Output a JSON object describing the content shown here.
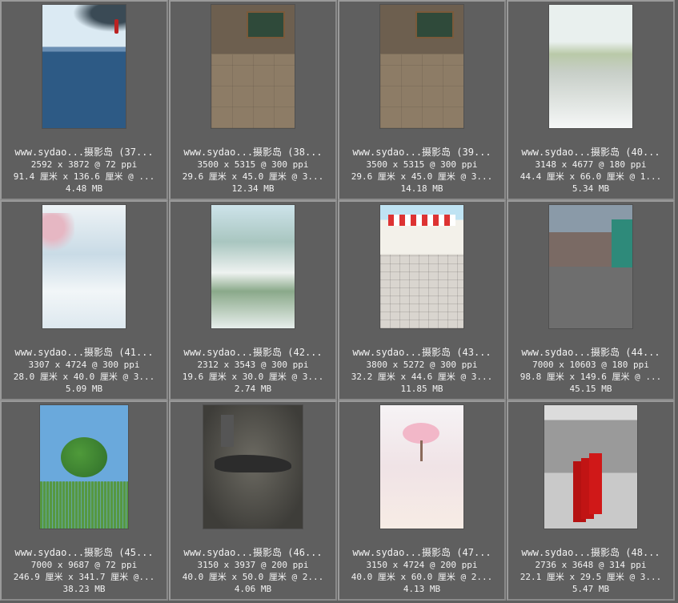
{
  "items": [
    {
      "name": "www.sydao...摄影岛 (37...",
      "dims": "2592 x 3872 @ 72 ppi",
      "size_cm": "91.4 厘米 x 136.6 厘米 @ ...",
      "filesize": "4.48 MB"
    },
    {
      "name": "www.sydao...摄影岛 (38...",
      "dims": "3500 x 5315 @ 300 ppi",
      "size_cm": "29.6 厘米 x 45.0 厘米 @ 3...",
      "filesize": "12.34 MB"
    },
    {
      "name": "www.sydao...摄影岛 (39...",
      "dims": "3500 x 5315 @ 300 ppi",
      "size_cm": "29.6 厘米 x 45.0 厘米 @ 3...",
      "filesize": "14.18 MB"
    },
    {
      "name": "www.sydao...摄影岛 (40...",
      "dims": "3148 x 4677 @ 180 ppi",
      "size_cm": "44.4 厘米 x 66.0 厘米 @ 1...",
      "filesize": "5.34 MB"
    },
    {
      "name": "www.sydao...摄影岛 (41...",
      "dims": "3307 x 4724 @ 300 ppi",
      "size_cm": "28.0 厘米 x 40.0 厘米 @ 3...",
      "filesize": "5.09 MB"
    },
    {
      "name": "www.sydao...摄影岛 (42...",
      "dims": "2312 x 3543 @ 300 ppi",
      "size_cm": "19.6 厘米 x 30.0 厘米 @ 3...",
      "filesize": "2.74 MB"
    },
    {
      "name": "www.sydao...摄影岛 (43...",
      "dims": "3800 x 5272 @ 300 ppi",
      "size_cm": "32.2 厘米 x 44.6 厘米 @ 3...",
      "filesize": "11.85 MB"
    },
    {
      "name": "www.sydao...摄影岛 (44...",
      "dims": "7000 x 10603 @ 180 ppi",
      "size_cm": "98.8 厘米 x 149.6 厘米 @ ...",
      "filesize": "45.15 MB"
    },
    {
      "name": "www.sydao...摄影岛 (45...",
      "dims": "7000 x 9687 @ 72 ppi",
      "size_cm": "246.9 厘米 x 341.7 厘米 @...",
      "filesize": "38.23 MB"
    },
    {
      "name": "www.sydao...摄影岛 (46...",
      "dims": "3150 x 3937 @ 200 ppi",
      "size_cm": "40.0 厘米 x 50.0 厘米 @ 2...",
      "filesize": "4.06 MB"
    },
    {
      "name": "www.sydao...摄影岛 (47...",
      "dims": "3150 x 4724 @ 200 ppi",
      "size_cm": "40.0 厘米 x 60.0 厘米 @ 2...",
      "filesize": "4.13 MB"
    },
    {
      "name": "www.sydao...摄影岛 (48...",
      "dims": "2736 x 3648 @ 314 ppi",
      "size_cm": "22.1 厘米 x 29.5 厘米 @ 3...",
      "filesize": "5.47 MB"
    }
  ]
}
